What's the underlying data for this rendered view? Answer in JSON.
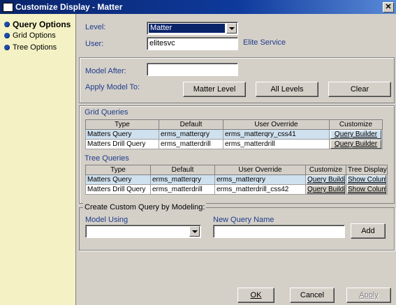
{
  "window": {
    "title": "Customize Display - Matter",
    "close_glyph": "✕"
  },
  "sidebar": {
    "items": [
      {
        "label": "Query Options"
      },
      {
        "label": "Grid Options"
      },
      {
        "label": "Tree Options"
      }
    ]
  },
  "top": {
    "level_label": "Level:",
    "level_value": "Matter",
    "user_label": "User:",
    "user_value": "elitesvc",
    "user_name": "Elite Service"
  },
  "model": {
    "model_after_label": "Model After:",
    "model_after_value": "",
    "apply_label": "Apply Model To:",
    "matter_level_button": "Matter Level",
    "all_levels_button": "All Levels",
    "clear_button": "Clear"
  },
  "grid_queries": {
    "title": "Grid Queries",
    "columns": [
      "Type",
      "Default",
      "User Override",
      "Customize"
    ],
    "rows": [
      {
        "type": "Matters Query",
        "default": "erms_matterqry",
        "override": "erms_matterqry_css41",
        "customize": "Query Builder"
      },
      {
        "type": "Matters Drill Query",
        "default": "erms_matterdrill",
        "override": "erms_matterdrill",
        "customize": "Query Builder"
      }
    ]
  },
  "tree_queries": {
    "title": "Tree Queries",
    "columns": [
      "Type",
      "Default",
      "User Override",
      "Customize",
      "Tree Display"
    ],
    "rows": [
      {
        "type": "Matters Query",
        "default": "erms_matterqry",
        "override": "erms_matterqry",
        "customize": "Query Builde",
        "display": "Show Colum"
      },
      {
        "type": "Matters Drill Query",
        "default": "erms_matterdrill",
        "override": "erms_matterdrill_css42",
        "customize": "Query Builde",
        "display": "Show Colum"
      }
    ]
  },
  "custom_query": {
    "title": "Create Custom Query by Modeling:",
    "model_using_label": "Model Using",
    "model_using_value": "",
    "new_query_label": "New Query Name",
    "new_query_value": "",
    "add_button": "Add"
  },
  "footer": {
    "ok_button": "OK",
    "cancel_button": "Cancel",
    "apply_button": "Apply"
  }
}
